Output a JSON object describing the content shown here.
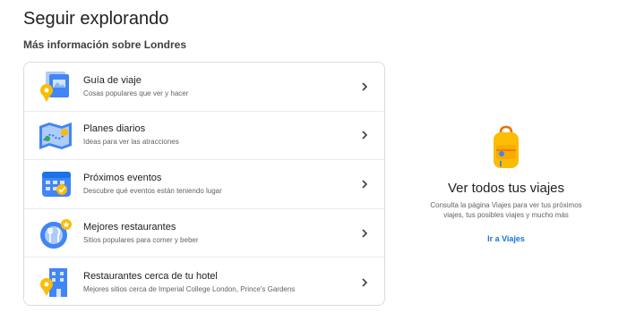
{
  "header": {
    "title": "Seguir explorando"
  },
  "section": {
    "title": "Más información sobre Londres"
  },
  "items": [
    {
      "title": "Guía de viaje",
      "subtitle": "Cosas populares que ver y hacer",
      "icon": "travel-guide-icon"
    },
    {
      "title": "Planes diarios",
      "subtitle": "Ideas para ver las atracciones",
      "icon": "map-icon"
    },
    {
      "title": "Próximos eventos",
      "subtitle": "Descubre qué eventos están teniendo lugar",
      "icon": "calendar-icon"
    },
    {
      "title": "Mejores restaurantes",
      "subtitle": "Sitios populares para comer y beber",
      "icon": "restaurant-icon"
    },
    {
      "title": "Restaurantes cerca de tu hotel",
      "subtitle": "Mejores sitios cerca de Imperial College London, Prince's Gardens",
      "icon": "hotel-icon"
    }
  ],
  "trips": {
    "icon": "backpack-icon",
    "title": "Ver todos tus viajes",
    "description_line1": "Consulta la página Viajes para ver tus próximos",
    "description_line2": "viajes, tus posibles viajes y mucho más",
    "link_label": "Ir a Viajes"
  },
  "colors": {
    "link": "#1a73e8",
    "blue": "#4285f4",
    "yellow": "#fbbc04",
    "border": "#dadce0"
  }
}
